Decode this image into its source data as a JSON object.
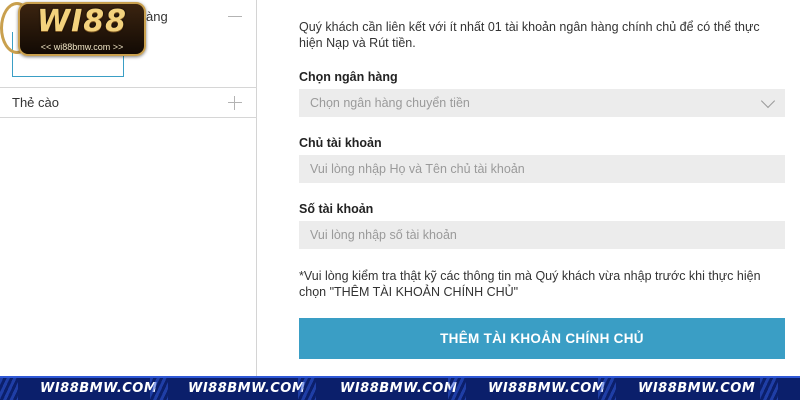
{
  "sidebar": {
    "bank_label_partial": "àng",
    "card_label": "Thẻ cào"
  },
  "logo": {
    "brand": "WI88",
    "url": "<< wi88bmw.com >>"
  },
  "form": {
    "notice": "Quý khách cần liên kết với ít nhất 01 tài khoản ngân hàng chính chủ để có thể thực hiện Nạp và Rút tiền.",
    "bank": {
      "label": "Chọn ngân hàng",
      "placeholder": "Chọn ngân hàng chuyển tiền"
    },
    "holder": {
      "label": "Chủ tài khoản",
      "placeholder": "Vui lòng nhập Họ và Tên chủ tài khoản"
    },
    "account_number": {
      "label": "Số tài khoản",
      "placeholder": "Vui lòng nhập số tài khoản"
    },
    "note": "*Vui lòng kiểm tra thật kỹ các thông tin mà Quý khách vừa nhập trước khi thực hiện chọn \"THÊM TÀI KHOẢN CHÍNH CHỦ\"",
    "submit_label": "THÊM TÀI KHOẢN CHÍNH CHỦ"
  },
  "banner": {
    "items": [
      "WI88BMW.COM",
      "WI88BMW.COM",
      "WI88BMW.COM",
      "WI88BMW.COM",
      "WI88BMW.COM"
    ]
  },
  "colors": {
    "accent": "#3a9ec5",
    "banner": "#0b1f6b",
    "field_bg": "#ececec"
  }
}
